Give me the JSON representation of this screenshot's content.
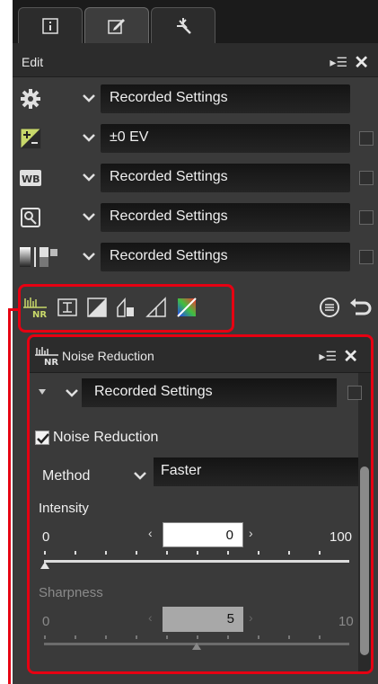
{
  "tabs": [
    {
      "name": "info-tab",
      "icon": "info-icon"
    },
    {
      "name": "edit-tab",
      "icon": "edit-icon",
      "active": true
    },
    {
      "name": "effects-tab",
      "icon": "sparkle-icon"
    }
  ],
  "edit_panel": {
    "title": "Edit",
    "menu_icon": "panel-menu-icon",
    "close": "✕"
  },
  "rows": [
    {
      "icon": "gear-icon",
      "value": "Recorded Settings",
      "checkbox": false
    },
    {
      "icon": "exposure-compensation-icon",
      "value": "±0 EV",
      "checkbox": true
    },
    {
      "icon": "white-balance-icon",
      "value": "Recorded Settings",
      "checkbox": true
    },
    {
      "icon": "picture-control-icon",
      "value": "Recorded Settings",
      "checkbox": true
    },
    {
      "icon": "tone-icon",
      "value": "Recorded Settings",
      "checkbox": true
    }
  ],
  "palette_icons": [
    "noise-reduction-icon",
    "crop-icon",
    "levels-curves-icon",
    "color-adjust-icon",
    "perspective-icon",
    "color-booster-icon"
  ],
  "right_icons": [
    "history-icon",
    "undo-icon"
  ],
  "noise_reduction": {
    "title": "Noise Reduction",
    "preset_value": "Recorded Settings",
    "toggle_label": "Noise Reduction",
    "toggle_checked": true,
    "method_label": "Method",
    "method_value": "Faster",
    "intensity": {
      "label": "Intensity",
      "value": "0",
      "min": "0",
      "max": "100"
    },
    "sharpness": {
      "label": "Sharpness",
      "value": "5",
      "min": "0",
      "max": "10"
    }
  },
  "colors": {
    "highlight": "#e60012",
    "panel": "#3a3a3a",
    "header": "#2c2c2c"
  }
}
